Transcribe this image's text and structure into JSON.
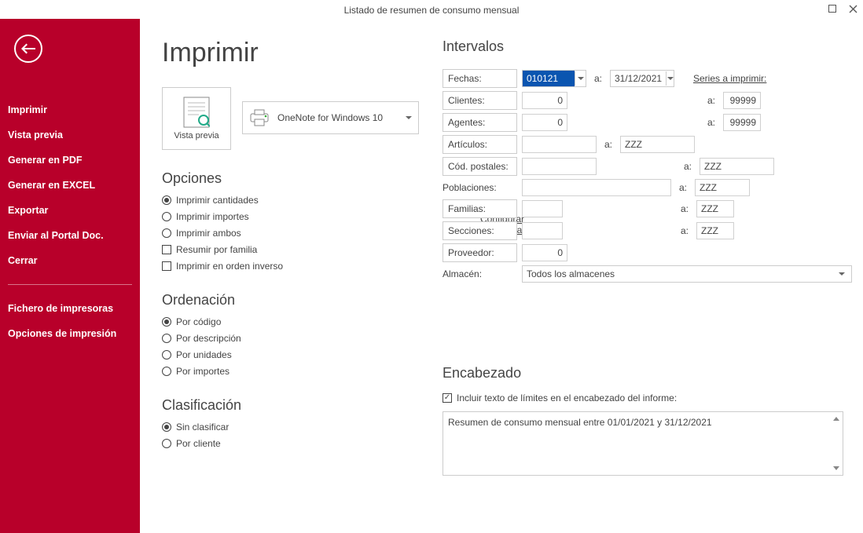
{
  "window": {
    "title": "Listado de resumen de consumo mensual"
  },
  "sidebar": {
    "items": [
      "Imprimir",
      "Vista previa",
      "Generar en PDF",
      "Generar en EXCEL",
      "Exportar",
      "Enviar al Portal Doc.",
      "Cerrar"
    ],
    "items2": [
      "Fichero de impresoras",
      "Opciones de impresión"
    ]
  },
  "page": {
    "title": "Imprimir",
    "preview_label": "Vista previa",
    "printer_name": "OneNote for Windows 10",
    "config_link": "Configurar impresora"
  },
  "opciones": {
    "title": "Opciones",
    "radios": [
      {
        "label": "Imprimir cantidades",
        "checked": true
      },
      {
        "label": "Imprimir importes",
        "checked": false
      },
      {
        "label": "Imprimir ambos",
        "checked": false
      }
    ],
    "checks": [
      {
        "label": "Resumir por familia",
        "checked": false
      },
      {
        "label": "Imprimir en orden inverso",
        "checked": false
      }
    ]
  },
  "ordenacion": {
    "title": "Ordenación",
    "radios": [
      {
        "label": "Por código",
        "checked": true
      },
      {
        "label": "Por descripción",
        "checked": false
      },
      {
        "label": "Por unidades",
        "checked": false
      },
      {
        "label": "Por importes",
        "checked": false
      }
    ]
  },
  "clasificacion": {
    "title": "Clasificación",
    "radios": [
      {
        "label": "Sin clasificar",
        "checked": true
      },
      {
        "label": "Por cliente",
        "checked": false
      }
    ]
  },
  "intervalos": {
    "title": "Intervalos",
    "a_label": "a:",
    "fechas": {
      "label": "Fechas:",
      "from": "010121",
      "to": "31/12/2021"
    },
    "series_link": "Series a imprimir:",
    "clientes": {
      "label": "Clientes:",
      "from": "0",
      "to": "99999"
    },
    "agentes": {
      "label": "Agentes:",
      "from": "0",
      "to": "99999"
    },
    "articulos": {
      "label": "Artículos:",
      "from": "",
      "to": "ZZZ"
    },
    "codpostales": {
      "label": "Cód. postales:",
      "from": "",
      "to": "ZZZ"
    },
    "poblaciones": {
      "label": "Poblaciones:",
      "from": "",
      "to": "ZZZ"
    },
    "familias": {
      "label": "Familias:",
      "from": "",
      "to": "ZZZ"
    },
    "secciones": {
      "label": "Secciones:",
      "from": "",
      "to": "ZZZ"
    },
    "proveedor": {
      "label": "Proveedor:",
      "value": "0"
    },
    "almacen": {
      "label": "Almacén:",
      "value": "Todos los almacenes"
    }
  },
  "encabezado": {
    "title": "Encabezado",
    "check_label": "Incluir texto de límites en el encabezado del informe:",
    "check_checked": true,
    "text": "Resumen de consumo mensual entre 01/01/2021 y 31/12/2021"
  }
}
